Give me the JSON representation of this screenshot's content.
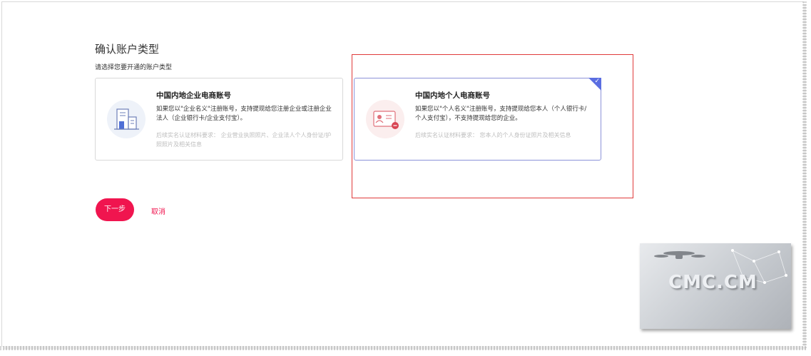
{
  "page": {
    "title": "确认账户类型",
    "subtitle": "请选择您要开通的账户类型"
  },
  "cards": {
    "enterprise": {
      "title": "中国内地企业电商账号",
      "description": "如果您以\"企业名义\"注册账号，支持提现给您注册企业或注册企业法人（企业银行卡/企业支付宝）。",
      "requirements": "后续实名认证材料要求： 企业营业执照照片、企业法人个人身份证/护照照片及相关信息",
      "icon": "building-icon",
      "selected": false
    },
    "personal": {
      "title": "中国内地个人电商账号",
      "description": "如果您以\"个人名义\"注册账号，支持提现给您本人（个人银行卡/个人支付宝），不支持提现给您的企业。",
      "requirements": "后续实名认证材料要求： 您本人的个人身份证照片及相关信息",
      "icon": "id-card-icon",
      "selected": true
    }
  },
  "actions": {
    "next_label": "下一步",
    "cancel_label": "取消"
  },
  "watermark": {
    "text": "CMC.CM"
  },
  "colors": {
    "accent": "#f0154f",
    "selected_border": "#8c93d9",
    "check_corner": "#5b6ee1",
    "highlight_box": "#e03a3a"
  }
}
